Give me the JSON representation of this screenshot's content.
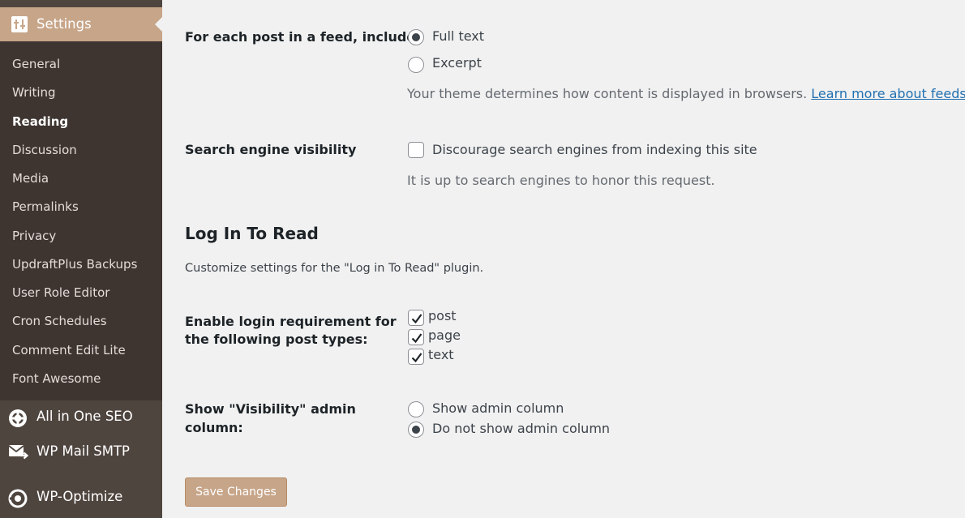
{
  "sidebar": {
    "settings_label": "Settings",
    "submenu": [
      {
        "label": "General"
      },
      {
        "label": "Writing"
      },
      {
        "label": "Reading",
        "current": true
      },
      {
        "label": "Discussion"
      },
      {
        "label": "Media"
      },
      {
        "label": "Permalinks"
      },
      {
        "label": "Privacy"
      },
      {
        "label": "UpdraftPlus Backups"
      },
      {
        "label": "User Role Editor"
      },
      {
        "label": "Cron Schedules"
      },
      {
        "label": "Comment Edit Lite"
      },
      {
        "label": "Font Awesome"
      }
    ],
    "plugins": [
      {
        "label": "All in One SEO",
        "icon": "gear-icon"
      },
      {
        "label": "WP Mail SMTP",
        "icon": "mail-icon"
      },
      {
        "label": "WP-Optimize",
        "icon": "wp-optimize-icon"
      }
    ]
  },
  "feed": {
    "label": "For each post in a feed, include",
    "options": [
      {
        "label": "Full text",
        "checked": true
      },
      {
        "label": "Excerpt",
        "checked": false
      }
    ],
    "description": "Your theme determines how content is displayed in browsers.",
    "link": "Learn more about feeds",
    "after_link": "."
  },
  "search_visibility": {
    "label": "Search engine visibility",
    "checkbox_label": "Discourage search engines from indexing this site",
    "checked": false,
    "description": "It is up to search engines to honor this request."
  },
  "login_to_read": {
    "title": "Log In To Read",
    "description": "Customize settings for the \"Log in To Read\" plugin.",
    "requirement_label_line1": "Enable login requirement for",
    "requirement_label_line2": "the following post types:",
    "post_types": [
      {
        "label": "post",
        "checked": true
      },
      {
        "label": "page",
        "checked": true
      },
      {
        "label": "text",
        "checked": true
      }
    ],
    "visibility_label_line1": "Show \"Visibility\" admin",
    "visibility_label_line2": "column:",
    "visibility_options": [
      {
        "label": "Show admin column",
        "checked": false
      },
      {
        "label": "Do not show admin column",
        "checked": true
      }
    ]
  },
  "save_label": "Save Changes",
  "colors": {
    "sidebar_bg": "#4f453f",
    "submenu_bg": "#3e3531",
    "accent": "#c7a589",
    "link": "#2271b1"
  }
}
